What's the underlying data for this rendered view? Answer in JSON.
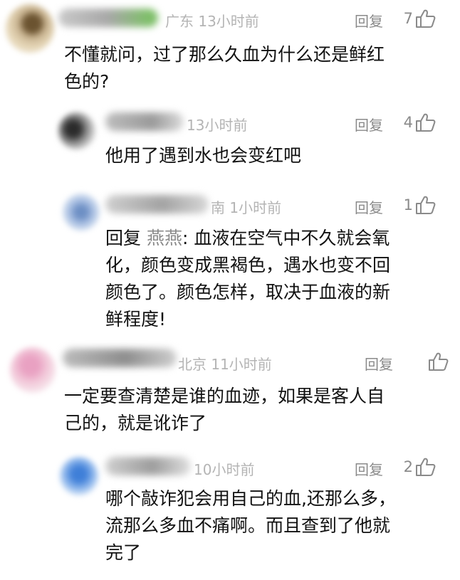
{
  "ui": {
    "reply_label": "回复"
  },
  "comments": {
    "c1": {
      "meta": "广东 13小时前",
      "likes": "7",
      "lines": [
        "不懂就问，过了那么久血为什么还是鲜红",
        "色的?"
      ]
    },
    "r1": {
      "meta": "13小时前",
      "likes": "4",
      "lines": [
        "他用了遇到水也会变红吧"
      ]
    },
    "r2": {
      "meta": "南 1小时前",
      "likes": "1",
      "prefix": "回复 ",
      "mention": "燕燕",
      "first_rest": ": 血液在空气中不久就会氧",
      "lines_after": [
        "化，颜色变成黑褐色，遇水也变不回",
        "颜色了。颜色怎样，取决于血液的新",
        "鲜程度!"
      ]
    },
    "c2": {
      "meta": "北京 11小时前",
      "likes": "",
      "lines": [
        "一定要查清楚是谁的血迹，如果是客人自",
        "己的，就是讹诈了"
      ]
    },
    "r3": {
      "meta": "10小时前",
      "likes": "2",
      "lines": [
        "哪个敲诈犯会用自己的血,还那么多，",
        "流那么多血不痛啊。而且查到了他就",
        "完了"
      ]
    }
  },
  "icons": {
    "like": "thumbs-up-icon"
  },
  "colors": {
    "meta": "#b4b4b4",
    "action": "#8a8a8a",
    "text": "#111111"
  }
}
